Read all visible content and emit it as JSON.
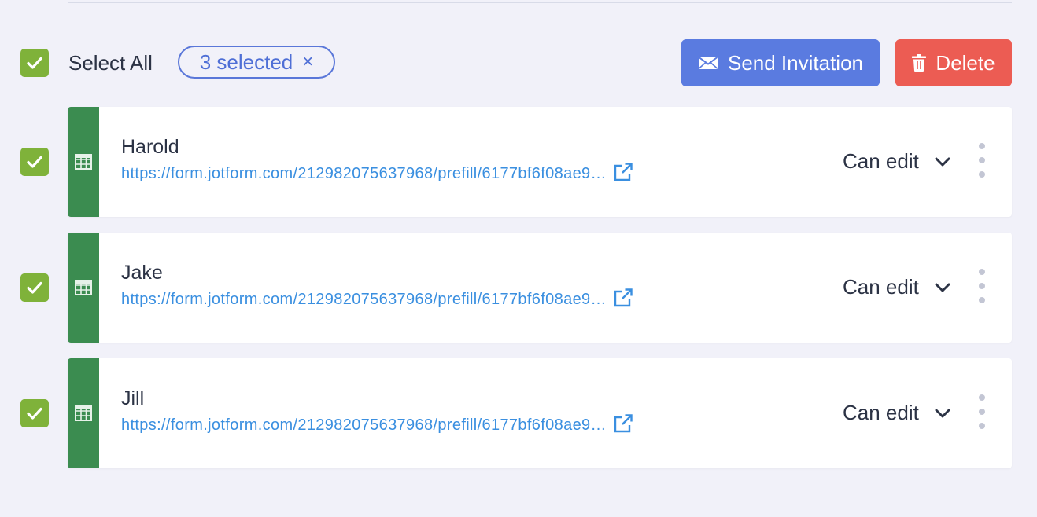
{
  "toolbar": {
    "select_all_label": "Select All",
    "selected_chip": "3 selected",
    "chip_close": "×",
    "send_label": "Send Invitation",
    "delete_label": "Delete"
  },
  "colors": {
    "checkbox": "#7fb23a",
    "send_button": "#5a7be0",
    "delete_button": "#ec5c53",
    "row_stripe": "#3b8c50",
    "link": "#3a8fe0"
  },
  "rows": [
    {
      "name": "Harold",
      "link": "https://form.jotform.com/212982075637968/prefill/6177bf6f08ae9…",
      "permission": "Can edit",
      "checked": true
    },
    {
      "name": "Jake",
      "link": "https://form.jotform.com/212982075637968/prefill/6177bf6f08ae9…",
      "permission": "Can edit",
      "checked": true
    },
    {
      "name": "Jill",
      "link": "https://form.jotform.com/212982075637968/prefill/6177bf6f08ae9…",
      "permission": "Can edit",
      "checked": true
    }
  ],
  "icons": {
    "checkbox": "check-icon",
    "send": "envelope-icon",
    "delete": "trash-icon",
    "row_type": "table-grid-icon",
    "open_link": "external-link-icon",
    "permission": "chevron-down-icon",
    "menu": "more-vertical-icon"
  }
}
